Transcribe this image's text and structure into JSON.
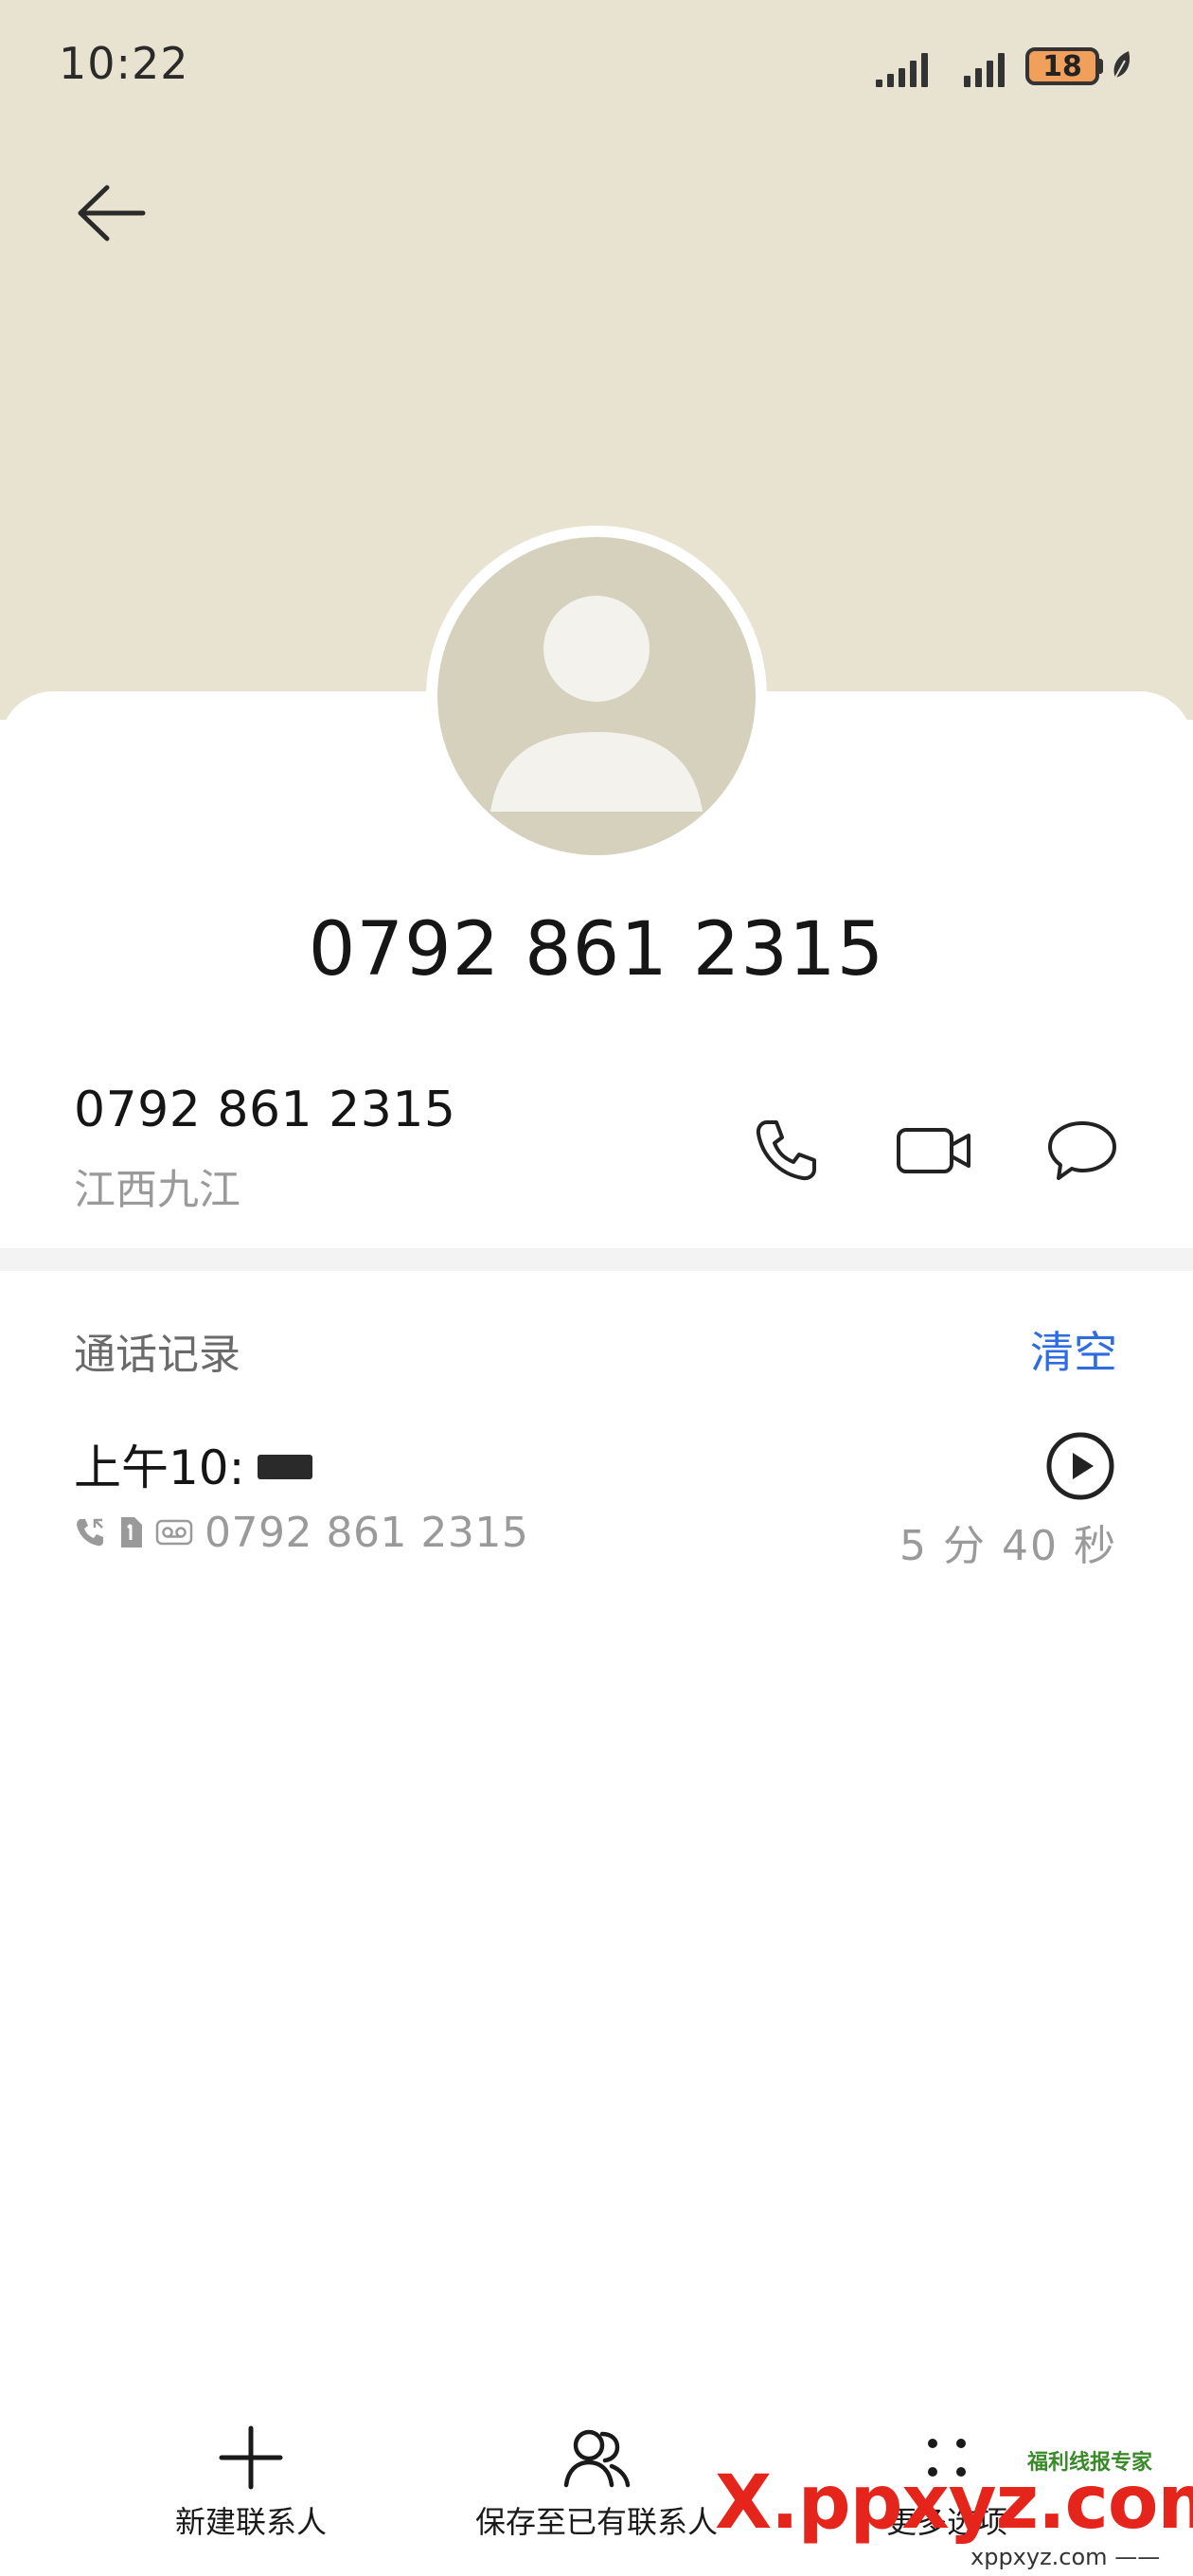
{
  "status_bar": {
    "time": "10:22",
    "battery": "18"
  },
  "contact": {
    "title": "0792 861 2315",
    "number": "0792 861 2315",
    "location": "江西九江"
  },
  "call_log": {
    "section_title": "通话记录",
    "clear_label": "清空",
    "records": [
      {
        "time": "上午10:",
        "number": "0792 861 2315",
        "duration": "5 分 40 秒"
      }
    ]
  },
  "bottom_bar": {
    "new_contact": "新建联系人",
    "save_existing": "保存至已有联系人",
    "more_options": "更多选项"
  },
  "watermark": {
    "main": "X.ppxyz.com",
    "top": "福利线报专家",
    "bottom": "xppxyz.com ——"
  },
  "colors": {
    "header_bg": "#e8e2d0",
    "accent": "#2f6ddf",
    "battery": "#f0a05a",
    "watermark": "#e5241b"
  }
}
